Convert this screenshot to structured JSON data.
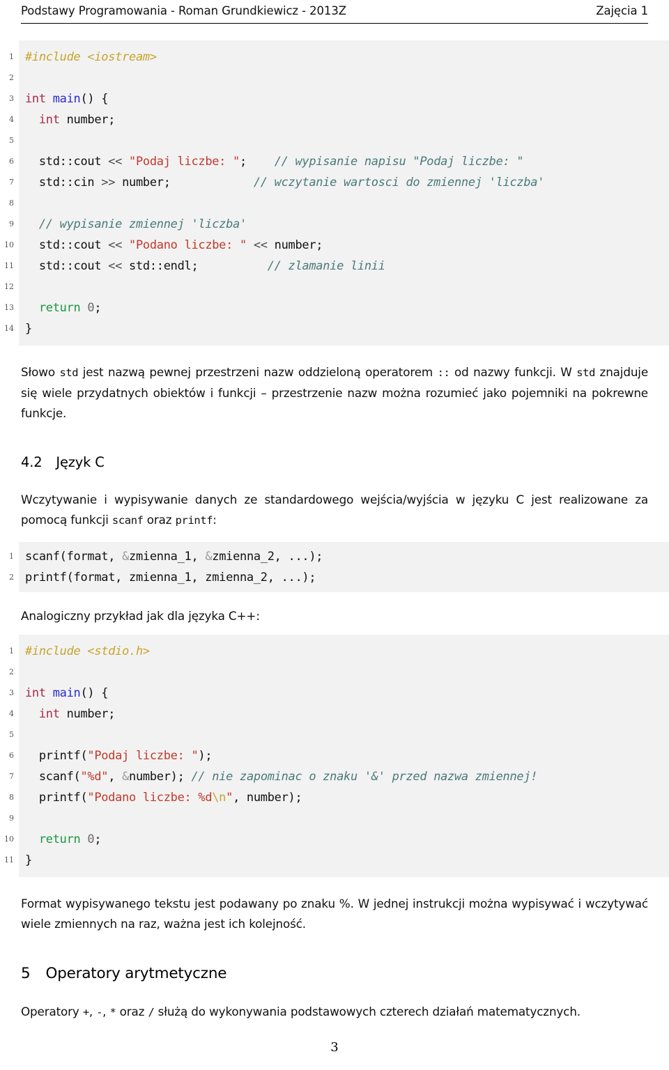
{
  "header": {
    "left": "Podstawy Programowania - Roman Grundkiewicz - 2013Z",
    "right": "Zajęcia 1"
  },
  "footer": {
    "page_number": "3"
  },
  "listing_cpp": {
    "lines": [
      {
        "n": "1",
        "tokens": [
          {
            "t": "#include <iostream>",
            "c": "pre"
          }
        ]
      },
      {
        "n": "2",
        "tokens": []
      },
      {
        "n": "3",
        "tokens": [
          {
            "t": "int",
            "c": "kw"
          },
          {
            "t": " ",
            "c": "plain"
          },
          {
            "t": "main",
            "c": "fn"
          },
          {
            "t": "() {",
            "c": "plain"
          }
        ]
      },
      {
        "n": "4",
        "tokens": [
          {
            "t": "  ",
            "c": "plain"
          },
          {
            "t": "int",
            "c": "kw"
          },
          {
            "t": " number;",
            "c": "plain"
          }
        ]
      },
      {
        "n": "5",
        "tokens": []
      },
      {
        "n": "6",
        "tokens": [
          {
            "t": "  std::cout ",
            "c": "plain"
          },
          {
            "t": "<<",
            "c": "op"
          },
          {
            "t": " ",
            "c": "plain"
          },
          {
            "t": "\"Podaj liczbe: \"",
            "c": "str"
          },
          {
            "t": ";    ",
            "c": "plain"
          },
          {
            "t": "// wypisanie napisu \"Podaj liczbe: \"",
            "c": "cmt"
          }
        ]
      },
      {
        "n": "7",
        "tokens": [
          {
            "t": "  std::cin ",
            "c": "plain"
          },
          {
            "t": ">>",
            "c": "op"
          },
          {
            "t": " number;            ",
            "c": "plain"
          },
          {
            "t": "// wczytanie wartosci do zmiennej 'liczba'",
            "c": "cmt"
          }
        ]
      },
      {
        "n": "8",
        "tokens": []
      },
      {
        "n": "9",
        "tokens": [
          {
            "t": "  ",
            "c": "plain"
          },
          {
            "t": "// wypisanie zmiennej 'liczba'",
            "c": "cmt"
          }
        ]
      },
      {
        "n": "10",
        "tokens": [
          {
            "t": "  std::cout ",
            "c": "plain"
          },
          {
            "t": "<<",
            "c": "op"
          },
          {
            "t": " ",
            "c": "plain"
          },
          {
            "t": "\"Podano liczbe: \"",
            "c": "str"
          },
          {
            "t": " ",
            "c": "plain"
          },
          {
            "t": "<<",
            "c": "op"
          },
          {
            "t": " number;",
            "c": "plain"
          }
        ]
      },
      {
        "n": "11",
        "tokens": [
          {
            "t": "  std::cout ",
            "c": "plain"
          },
          {
            "t": "<<",
            "c": "op"
          },
          {
            "t": " std::endl;          ",
            "c": "plain"
          },
          {
            "t": "// zlamanie linii",
            "c": "cmt"
          }
        ]
      },
      {
        "n": "12",
        "tokens": []
      },
      {
        "n": "13",
        "tokens": [
          {
            "t": "  ",
            "c": "plain"
          },
          {
            "t": "return",
            "c": "kw-ret"
          },
          {
            "t": " ",
            "c": "plain"
          },
          {
            "t": "0",
            "c": "num"
          },
          {
            "t": ";",
            "c": "plain"
          }
        ]
      },
      {
        "n": "14",
        "tokens": [
          {
            "t": "}",
            "c": "plain"
          }
        ]
      }
    ]
  },
  "para_std": {
    "segments": [
      {
        "t": "Słowo ",
        "m": false
      },
      {
        "t": "std",
        "m": true
      },
      {
        "t": " jest nazwą pewnej przestrzeni nazw oddzieloną operatorem ",
        "m": false
      },
      {
        "t": "::",
        "m": true
      },
      {
        "t": " od nazwy funkcji. W ",
        "m": false
      },
      {
        "t": "std",
        "m": true
      },
      {
        "t": " znajduje się wiele przydatnych obiektów i funkcji – przestrzenie nazw można rozumieć jako pojemniki na pokrewne funkcje.",
        "m": false
      }
    ]
  },
  "section_42": {
    "number": "4.2",
    "title": "Język C"
  },
  "para_c_intro": {
    "segments": [
      {
        "t": "Wczytywanie i wypisywanie danych ze standardowego wejścia/wyjścia w języku C jest realizowane za pomocą funkcji ",
        "m": false
      },
      {
        "t": "scanf",
        "m": true
      },
      {
        "t": " oraz ",
        "m": false
      },
      {
        "t": "printf",
        "m": true
      },
      {
        "t": ":",
        "m": false
      }
    ]
  },
  "listing_sig": {
    "lines": [
      {
        "n": "1",
        "tokens": [
          {
            "t": "scanf(format, ",
            "c": "plain"
          },
          {
            "t": "&",
            "c": "amp"
          },
          {
            "t": "zmienna_1, ",
            "c": "plain"
          },
          {
            "t": "&",
            "c": "amp"
          },
          {
            "t": "zmienna_2, ...);",
            "c": "plain"
          }
        ]
      },
      {
        "n": "2",
        "tokens": [
          {
            "t": "printf(format, zmienna_1, zmienna_2, ...);",
            "c": "plain"
          }
        ]
      }
    ]
  },
  "para_analog": {
    "segments": [
      {
        "t": "Analogiczny przykład jak dla języka C++:",
        "m": false
      }
    ]
  },
  "listing_c": {
    "lines": [
      {
        "n": "1",
        "tokens": [
          {
            "t": "#include <stdio.h>",
            "c": "pre"
          }
        ]
      },
      {
        "n": "2",
        "tokens": []
      },
      {
        "n": "3",
        "tokens": [
          {
            "t": "int",
            "c": "kw"
          },
          {
            "t": " ",
            "c": "plain"
          },
          {
            "t": "main",
            "c": "fn"
          },
          {
            "t": "() {",
            "c": "plain"
          }
        ]
      },
      {
        "n": "4",
        "tokens": [
          {
            "t": "  ",
            "c": "plain"
          },
          {
            "t": "int",
            "c": "kw"
          },
          {
            "t": " number;",
            "c": "plain"
          }
        ]
      },
      {
        "n": "5",
        "tokens": []
      },
      {
        "n": "6",
        "tokens": [
          {
            "t": "  printf(",
            "c": "plain"
          },
          {
            "t": "\"Podaj liczbe: \"",
            "c": "str"
          },
          {
            "t": ");",
            "c": "plain"
          }
        ]
      },
      {
        "n": "7",
        "tokens": [
          {
            "t": "  scanf(",
            "c": "plain"
          },
          {
            "t": "\"%d\"",
            "c": "str"
          },
          {
            "t": ", ",
            "c": "plain"
          },
          {
            "t": "&",
            "c": "amp"
          },
          {
            "t": "number); ",
            "c": "plain"
          },
          {
            "t": "// nie zapominac o znaku '&' przed nazwa zmiennej!",
            "c": "cmt"
          }
        ]
      },
      {
        "n": "8",
        "tokens": [
          {
            "t": "  printf(",
            "c": "plain"
          },
          {
            "t": "\"Podano liczbe: %d",
            "c": "str"
          },
          {
            "t": "\\n",
            "c": "esc"
          },
          {
            "t": "\"",
            "c": "str"
          },
          {
            "t": ", number);",
            "c": "plain"
          }
        ]
      },
      {
        "n": "9",
        "tokens": []
      },
      {
        "n": "10",
        "tokens": [
          {
            "t": "  ",
            "c": "plain"
          },
          {
            "t": "return",
            "c": "kw-ret"
          },
          {
            "t": " ",
            "c": "plain"
          },
          {
            "t": "0",
            "c": "num"
          },
          {
            "t": ";",
            "c": "plain"
          }
        ]
      },
      {
        "n": "11",
        "tokens": [
          {
            "t": "}",
            "c": "plain"
          }
        ]
      }
    ]
  },
  "para_format": {
    "segments": [
      {
        "t": "Format wypisywanego tekstu jest podawany po znaku %. W jednej instrukcji można wypisywać i wczytywać wiele zmiennych na raz, ważna jest ich kolejność.",
        "m": false
      }
    ]
  },
  "section_5": {
    "number": "5",
    "title": "Operatory arytmetyczne"
  },
  "para_operators": {
    "segments": [
      {
        "t": "Operatory ",
        "m": false
      },
      {
        "t": "+",
        "m": true
      },
      {
        "t": ", ",
        "m": false
      },
      {
        "t": "-",
        "m": true
      },
      {
        "t": ", ",
        "m": false
      },
      {
        "t": "*",
        "m": true
      },
      {
        "t": " oraz ",
        "m": false
      },
      {
        "t": "/",
        "m": true
      },
      {
        "t": " służą do wykonywania podstawowych czterech działań matematycznych.",
        "m": false
      }
    ]
  },
  "colors": {
    "listing_background": "#f2f2f2",
    "keyword": "#a52a4a",
    "return_keyword": "#1a9641",
    "function": "#2a2ad0",
    "string": "#c0392b",
    "comment": "#4a7a78",
    "preprocessor": "#c8a42c",
    "escape": "#c8a42c",
    "ampersand": "#9a9a9a",
    "line_number": "#555555",
    "text": "#111111"
  }
}
